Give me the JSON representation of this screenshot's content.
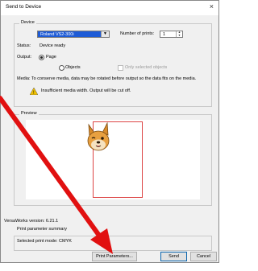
{
  "window": {
    "title": "Send to Device",
    "close_glyph": "×"
  },
  "device": {
    "group_label": "Device",
    "printer_value": "Roland VS2-300i",
    "copies_label": "Number of prints:",
    "copies_value": "1",
    "status_label": "Status:",
    "status_value": "Device ready",
    "output_label": "Output:",
    "output_options": [
      "Page",
      "Objects"
    ],
    "output_selected": "Page",
    "only_selected_label": "Only selected objects",
    "media_message": "Media: To conserve media, data may be rotated before output so the data fits on the media.",
    "warning_text": "Insufficient media width. Output will be cut off."
  },
  "preview": {
    "group_label": "Preview"
  },
  "footer": {
    "version": "VersaWorks version: 6.21.1",
    "summary_title": "Print parameter summary",
    "print_mode": "Selected print mode:  CMYK"
  },
  "buttons": {
    "print_params": "Print Parameters...",
    "send": "Send",
    "cancel": "Cancel"
  },
  "colors": {
    "accent": "#1e5bd6",
    "arrow": "#e11010",
    "page_outline": "#d44444",
    "warning": "#f3c300"
  },
  "icons": [
    "close-icon",
    "dropdown-icon",
    "spinner-icon",
    "warning-icon",
    "dog-preview-image",
    "annotation-arrow"
  ]
}
